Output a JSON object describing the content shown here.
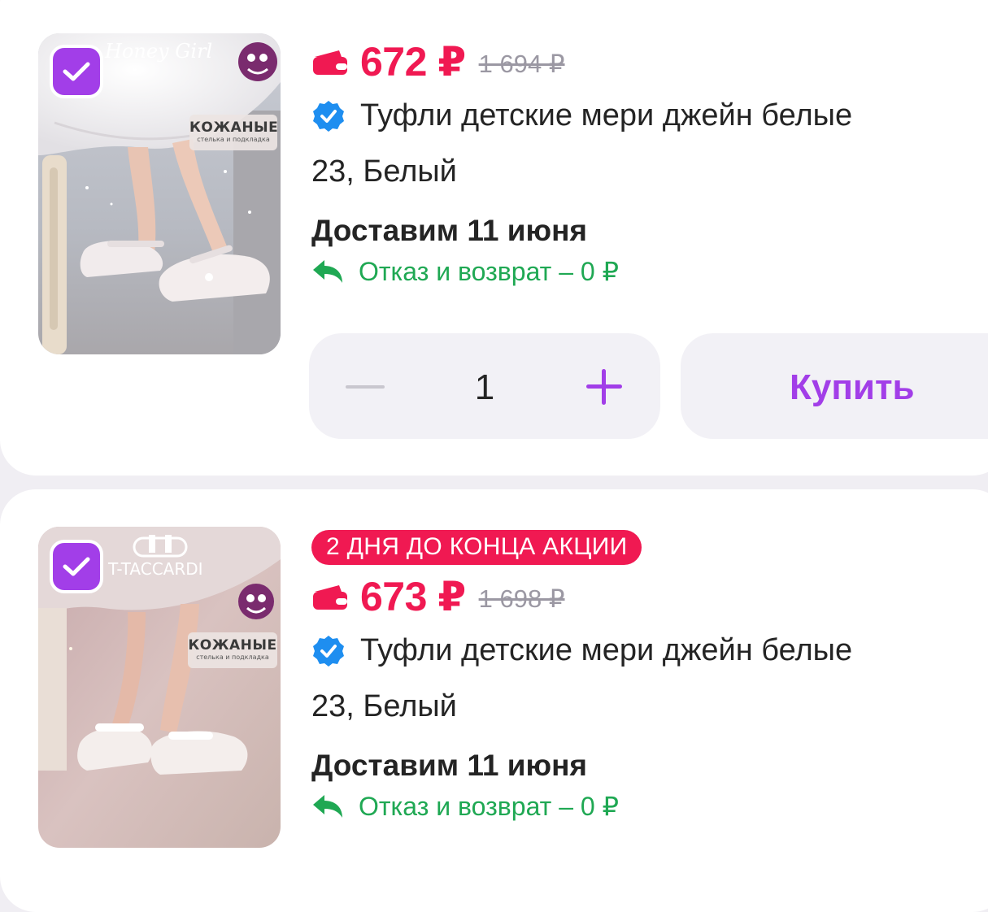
{
  "items": [
    {
      "brand": "Honey Girl",
      "badge_main": "КОЖАНЫЕ",
      "badge_sub": "стелька и подкладка",
      "price": "672 ₽",
      "old_price": "1 694 ₽",
      "title": "Туфли детские мери джейн белые",
      "variant": "23, Белый",
      "delivery": "Доставим 11 июня",
      "return_policy": "Отказ и возврат – 0 ₽",
      "quantity": "1",
      "buy_label": "Купить",
      "checked": true
    },
    {
      "brand": "T-TACCARDI",
      "badge_main": "КОЖАНЫЕ",
      "badge_sub": "стелька и подкладка",
      "promo": "2 ДНЯ ДО КОНЦА АКЦИИ",
      "price": "673 ₽",
      "old_price": "1 698 ₽",
      "title": "Туфли детские мери джейн белые",
      "variant": "23, Белый",
      "delivery": "Доставим 11 июня",
      "return_policy": "Отказ и возврат – 0 ₽",
      "checked": true
    }
  ],
  "colors": {
    "accent": "#a23ee8",
    "price": "#f01952",
    "return": "#1fa853",
    "verified": "#1e8ef0",
    "background": "#f0eef3"
  },
  "icons": [
    "check-icon",
    "wallet-icon",
    "verified-icon",
    "return-arrow-icon",
    "minus-icon",
    "plus-icon"
  ]
}
